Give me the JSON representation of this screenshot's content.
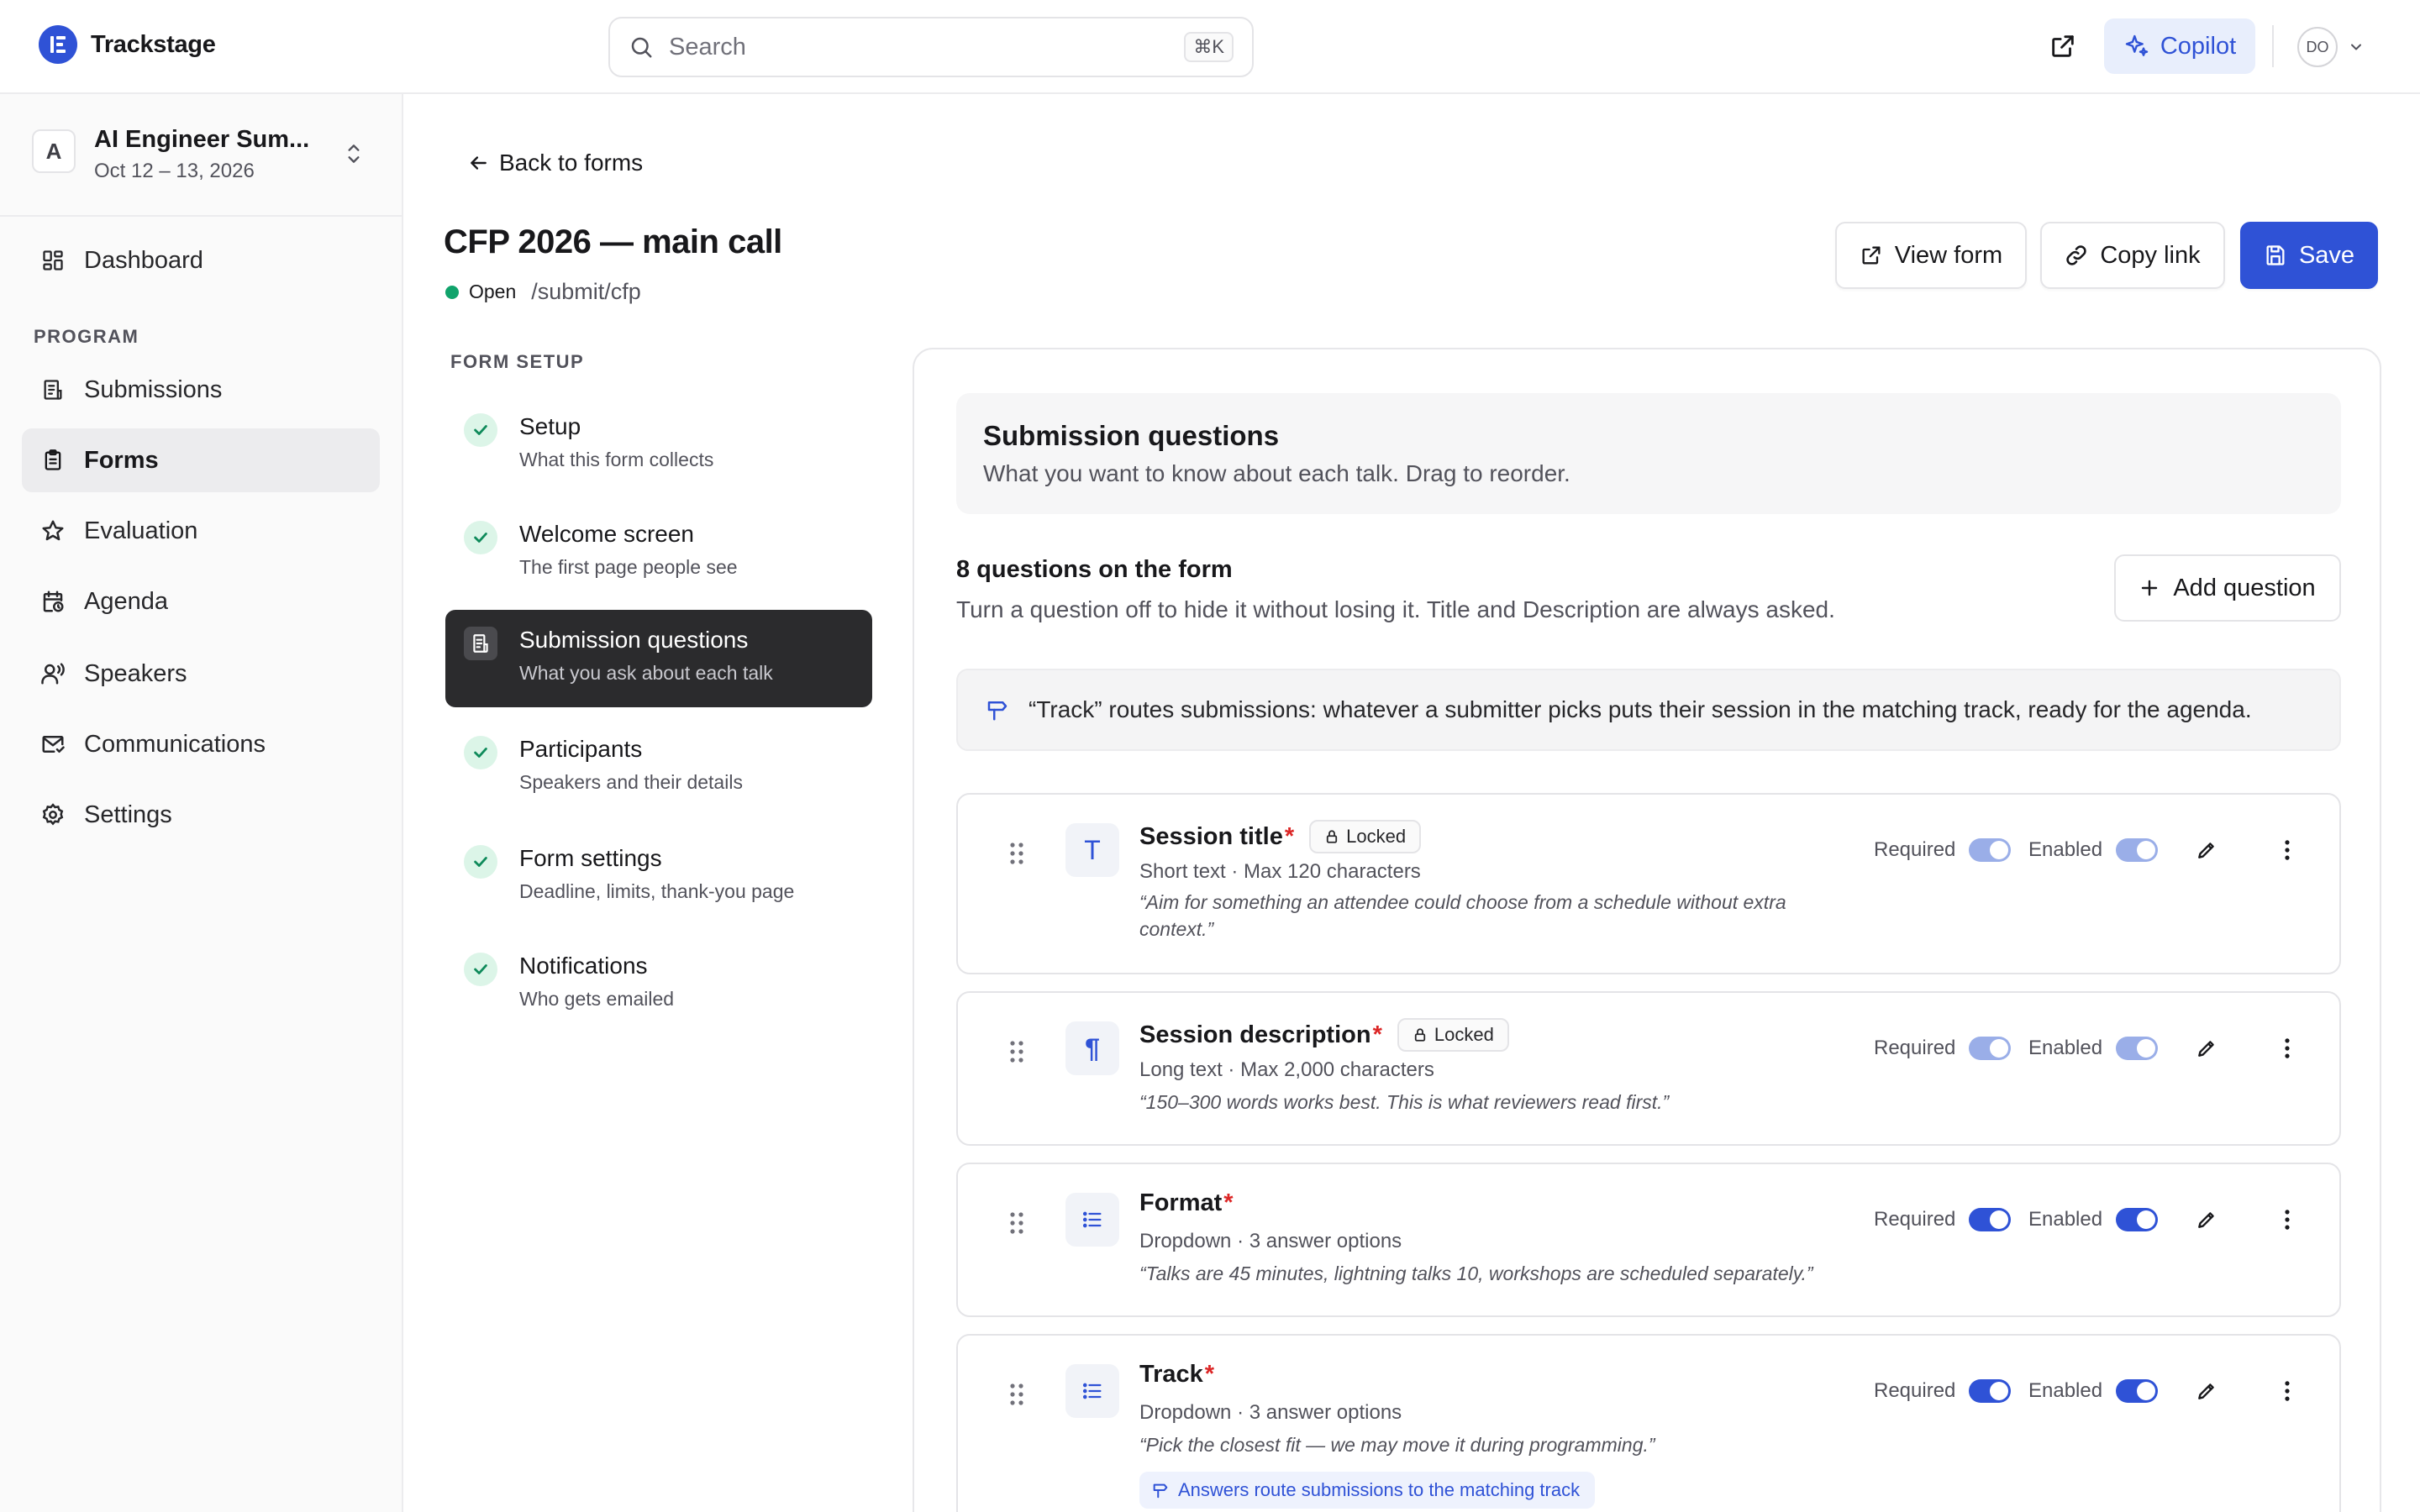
{
  "app": {
    "name": "Trackstage"
  },
  "search": {
    "placeholder": "Search",
    "shortcut": "⌘K"
  },
  "topbar": {
    "copilot_label": "Copilot",
    "user_initials": "DO"
  },
  "event": {
    "avatar_letter": "A",
    "name": "AI Engineer Sum...",
    "dates": "Oct 12 – 13, 2026"
  },
  "sidebar": {
    "dashboard": "Dashboard",
    "section_label": "PROGRAM",
    "items": [
      {
        "label": "Submissions",
        "icon": "submissions-icon"
      },
      {
        "label": "Forms",
        "icon": "forms-icon",
        "active": true
      },
      {
        "label": "Evaluation",
        "icon": "star-icon"
      },
      {
        "label": "Agenda",
        "icon": "calendar-icon"
      },
      {
        "label": "Speakers",
        "icon": "speakers-icon"
      },
      {
        "label": "Communications",
        "icon": "mail-icon"
      },
      {
        "label": "Settings",
        "icon": "gear-icon"
      }
    ]
  },
  "page": {
    "back_label": "Back to forms",
    "title": "CFP 2026 — main call",
    "status": "Open",
    "path": "/submit/cfp",
    "view_form_label": "View form",
    "copy_link_label": "Copy link",
    "save_label": "Save"
  },
  "form_setup": {
    "label": "FORM SETUP",
    "steps": [
      {
        "title": "Setup",
        "subtitle": "What this form collects",
        "done": true
      },
      {
        "title": "Welcome screen",
        "subtitle": "The first page people see",
        "done": true
      },
      {
        "title": "Submission questions",
        "subtitle": "What you ask about each talk",
        "active": true
      },
      {
        "title": "Participants",
        "subtitle": "Speakers and their details",
        "done": true
      },
      {
        "title": "Form settings",
        "subtitle": "Deadline, limits, thank-you page",
        "done": true
      },
      {
        "title": "Notifications",
        "subtitle": "Who gets emailed",
        "done": true
      }
    ]
  },
  "panel": {
    "title": "Submission questions",
    "subtitle": "What you want to know about each talk. Drag to reorder.",
    "count_label": "8 questions on the form",
    "hint": "Turn a question off to hide it without losing it. Title and Description are always asked.",
    "add_label": "Add question",
    "route_note": "“Track” routes submissions: whatever a submitter picks puts their session in the matching track, ready for the agenda."
  },
  "toggle_labels": {
    "required": "Required",
    "enabled": "Enabled"
  },
  "questions": [
    {
      "title": "Session title",
      "star": "*",
      "locked_label": "Locked",
      "icon_glyph": "T",
      "meta": "Short text · Max 120 characters",
      "help": "“Aim for something an attendee could choose from a schedule without extra context.”",
      "required": true,
      "enabled": true,
      "locked": true
    },
    {
      "title": "Session description",
      "star": "*",
      "locked_label": "Locked",
      "icon_glyph": "¶",
      "meta": "Long text · Max 2,000 characters",
      "help": "“150–300 words works best. This is what reviewers read first.”",
      "required": true,
      "enabled": true,
      "locked": true
    },
    {
      "title": "Format",
      "star": "*",
      "icon_glyph": "list",
      "meta": "Dropdown · 3 answer options",
      "help": "“Talks are 45 minutes, lightning talks 10, workshops are scheduled separately.”",
      "required": true,
      "enabled": true
    },
    {
      "title": "Track",
      "star": "*",
      "icon_glyph": "list",
      "meta": "Dropdown · 3 answer options",
      "help": "“Pick the closest fit — we may move it during programming.”",
      "route_pill": "Answers route submissions to the matching track",
      "required": true,
      "enabled": true
    }
  ],
  "colors": {
    "accent": "#2f52d6",
    "success": "#10a36b",
    "required_star": "#dc2626",
    "active_step_bg": "#2b2b2d"
  }
}
